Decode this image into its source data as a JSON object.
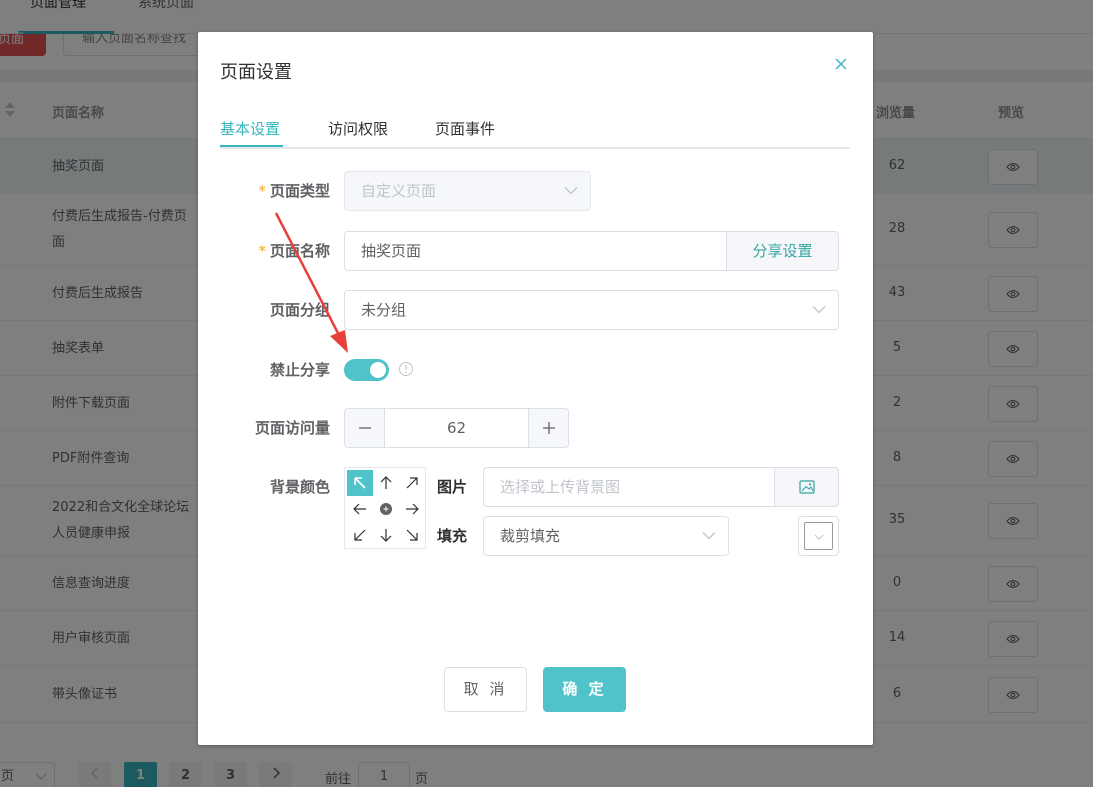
{
  "background": {
    "tabs": [
      "页面管理",
      "系统页面"
    ],
    "new_button": "页面",
    "search_placeholder": "输入页面名称查找",
    "table": {
      "col_name": "页面名称",
      "col_views": "浏览量",
      "col_preview": "预览",
      "rows": [
        {
          "name": "抽奖页面",
          "views": "62"
        },
        {
          "name": "付费后生成报告-付费页面",
          "views": "28"
        },
        {
          "name": "付费后生成报告",
          "views": "43"
        },
        {
          "name": "抽奖表单",
          "views": "5"
        },
        {
          "name": "附件下载页面",
          "views": "2"
        },
        {
          "name": "PDF附件查询",
          "views": "8"
        },
        {
          "name": "2022和合文化全球论坛人员健康申报",
          "views": "35"
        },
        {
          "name": "信息查询进度",
          "views": "0"
        },
        {
          "name": "用户审核页面",
          "views": "14"
        },
        {
          "name": "带头像证书",
          "views": "6"
        }
      ]
    },
    "pager": {
      "size_label": "页",
      "pages": [
        "1",
        "2",
        "3"
      ],
      "goto_label": "前往",
      "goto_value": "1",
      "page_suffix": "页"
    }
  },
  "dialog": {
    "title": "页面设置",
    "tabs": [
      "基本设置",
      "访问权限",
      "页面事件"
    ],
    "fields": {
      "page_type_label": "页面类型",
      "page_type_value": "自定义页面",
      "page_name_label": "页面名称",
      "page_name_value": "抽奖页面",
      "share_settings": "分享设置",
      "page_group_label": "页面分组",
      "page_group_value": "未分组",
      "disable_share_label": "禁止分享",
      "disable_share_on": true,
      "visits_label": "页面访问量",
      "visits_value": "62",
      "bg_color_label": "背景颜色",
      "image_label": "图片",
      "image_placeholder": "选择或上传背景图",
      "fill_label": "填充",
      "fill_value": "裁剪填充"
    },
    "buttons": {
      "cancel": "取 消",
      "ok": "确 定"
    }
  },
  "colors": {
    "accent": "#36b7be",
    "switch_on": "#4fc3c9",
    "annotation_arrow": "#e8403a",
    "required_mark": "#f5a623"
  }
}
